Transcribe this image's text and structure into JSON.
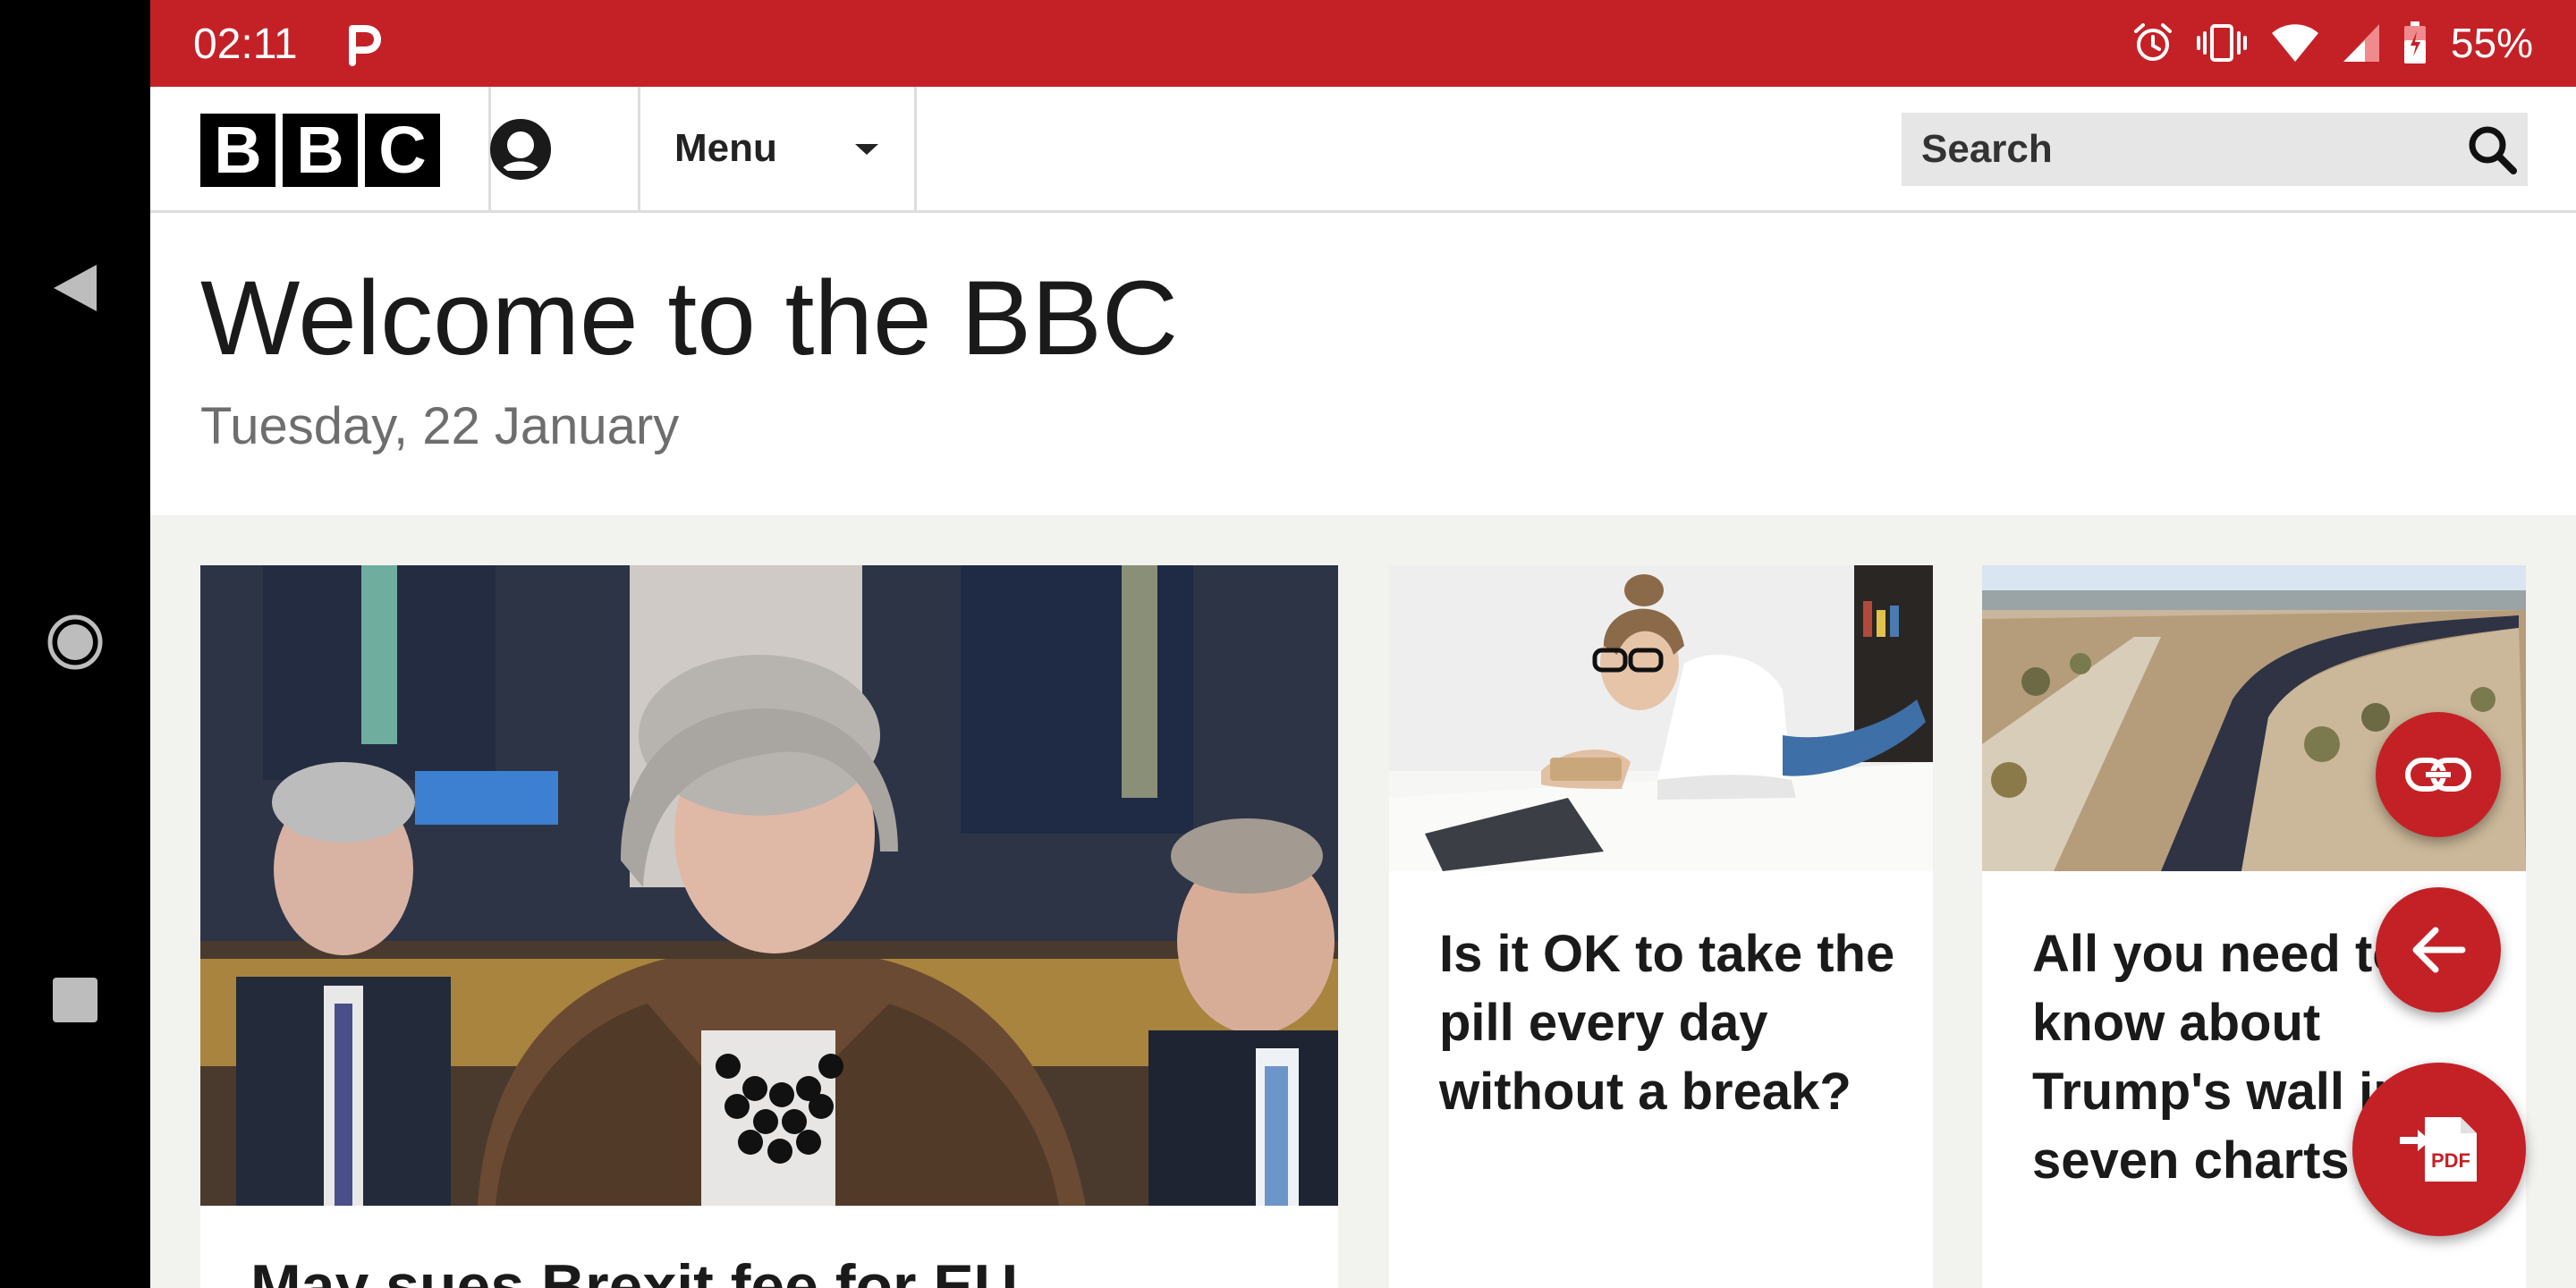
{
  "status_bar": {
    "time": "02:11",
    "battery": "55%",
    "icons": [
      "parking-app-icon",
      "alarm-icon",
      "vibrate-icon",
      "wifi-icon",
      "signal-icon",
      "battery-icon"
    ]
  },
  "header": {
    "logo_letters": [
      "B",
      "B",
      "C"
    ],
    "menu_label": "Menu",
    "search_placeholder": "Search"
  },
  "welcome": {
    "title": "Welcome to the BBC",
    "date": "Tuesday, 22 January"
  },
  "cards": [
    {
      "title": "May sues Brexit fee for EU"
    },
    {
      "title": "Is it OK to take the pill every day without a break?"
    },
    {
      "title": "All you need to know about Trump's wall in seven charts"
    }
  ],
  "fabs": [
    "link-icon",
    "arrow-back-icon",
    "pdf-icon"
  ],
  "colors": {
    "brand_red": "#c42127",
    "header_bg": "#ffffff",
    "page_bg": "#f2f2ef"
  }
}
